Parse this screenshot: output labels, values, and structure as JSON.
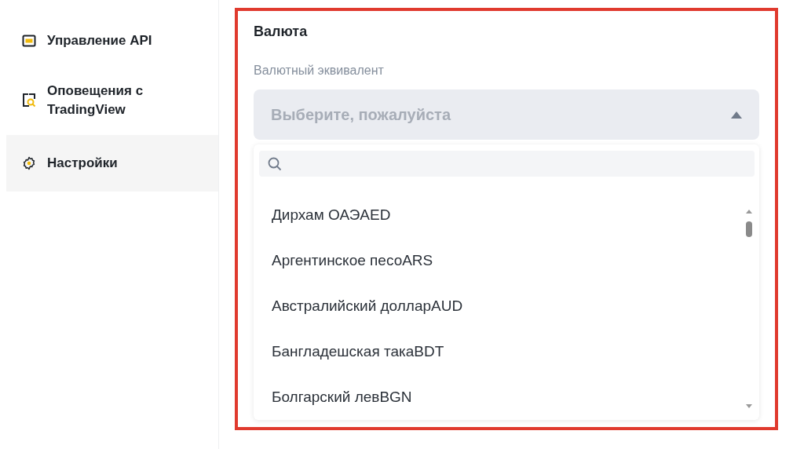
{
  "sidebar": {
    "items": [
      {
        "label": "Управление API",
        "kind": "api",
        "selected": false
      },
      {
        "label": "Оповещения с TradingView",
        "kind": "alert",
        "selected": false
      },
      {
        "label": "Настройки",
        "kind": "settings",
        "selected": true
      }
    ]
  },
  "section": {
    "title": "Валюта",
    "field_label": "Валютный эквивалент",
    "select": {
      "placeholder": "Выберите, пожалуйста",
      "expanded": true
    },
    "options": [
      "Дирхам ОАЭAED",
      "Аргентинское песоARS",
      "Австралийский долларAUD",
      "Бангладешская такаBDT",
      "Болгарский левBGN"
    ]
  }
}
